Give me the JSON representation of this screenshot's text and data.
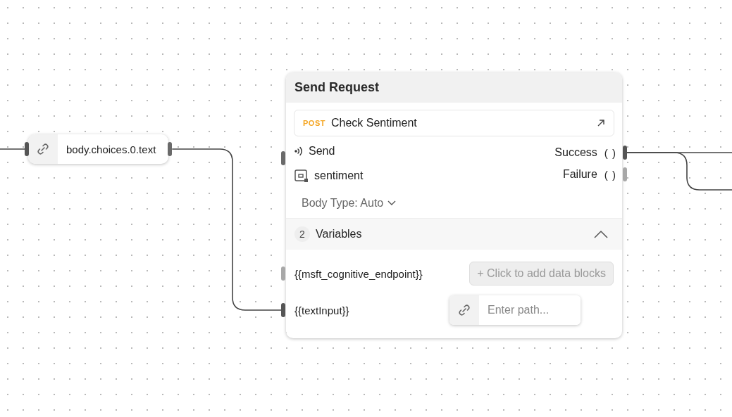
{
  "source_node": {
    "value": "body.choices.0.text",
    "incoming": true
  },
  "request_node": {
    "title": "Send Request",
    "request": {
      "method": "POST",
      "name": "Check Sentiment"
    },
    "trigger": {
      "label": "Send"
    },
    "result": {
      "label": "sentiment"
    },
    "outputs": [
      {
        "label": "Success",
        "symbol": "( )",
        "connected": true
      },
      {
        "label": "Failure",
        "symbol": "( )",
        "connected": false
      }
    ],
    "body_type": "Body Type: Auto",
    "variables": {
      "count": "2",
      "title": "Variables",
      "expanded": true,
      "items": [
        {
          "name": "{{msft_cognitive_endpoint}}",
          "kind": "blocks",
          "button": "+ Click to add data blocks",
          "connected": false
        },
        {
          "name": "{{textInput}}",
          "kind": "path",
          "placeholder": "Enter path...",
          "connected": true
        }
      ]
    }
  }
}
